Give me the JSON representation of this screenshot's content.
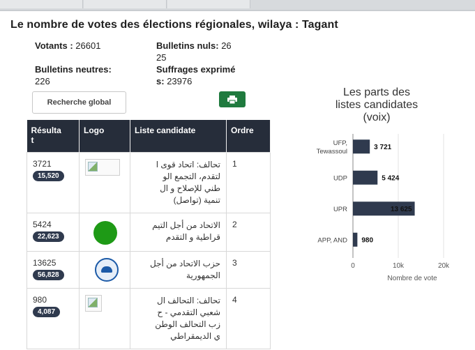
{
  "title": "Le nombre de votes des élections régionales, wilaya : Tagant",
  "stats": {
    "votants_label": "Votants :",
    "votants_value": "26601",
    "nuls_label": "Bulletins nuls:",
    "nuls_value_1": "26",
    "nuls_value_2": "25",
    "neutres_label": "Bulletins neutres:",
    "neutres_value": "226",
    "exprimes_label_1": "Suffrages exprimé",
    "exprimes_label_2": "s:",
    "exprimes_value": "23976"
  },
  "buttons": {
    "search_label": "Recherche global",
    "print_icon": "print-icon"
  },
  "table": {
    "headers": {
      "result_1": "Résulta",
      "result_2": "t",
      "logo": "Logo",
      "list": "Liste candidate",
      "order": "Ordre"
    },
    "rows": [
      {
        "votes": "3721",
        "badge": "15,520",
        "logo": "broken-image",
        "name_lines": [
          "تحالف: اتحاد قوى ا",
          "لتقدم، التجمع الو",
          "طني للإصلاح و ال",
          "تنمية (تواصل)"
        ],
        "order": "1"
      },
      {
        "votes": "5424",
        "badge": "22,623",
        "logo": "green-circle",
        "name_lines": [
          "الاتحاد من أجل التيم",
          "قراطية و التقدم"
        ],
        "order": "2"
      },
      {
        "votes": "13625",
        "badge": "56,828",
        "logo": "upr-emblem",
        "name_lines": [
          "حزب الاتحاد من أجل",
          "الجمهورية"
        ],
        "order": "3"
      },
      {
        "votes": "980",
        "badge": "4,087",
        "logo": "broken-image",
        "name_lines": [
          "تحالف: التحالف ال",
          "شعبي التقدمي - ح",
          "زب التحالف الوطن",
          "ي الديمقراطي"
        ],
        "order": "4"
      }
    ]
  },
  "chart_title_lines": [
    "Les parts des",
    "listes candidates",
    "(voix)"
  ],
  "chart_data": {
    "type": "bar",
    "orientation": "horizontal",
    "title": "Les parts des listes candidates (voix)",
    "categories": [
      "UFP, Tewassoul",
      "UDP",
      "UPR",
      "APP, AND"
    ],
    "category_lines": [
      [
        "UFP,",
        "Tewassoul"
      ],
      [
        "UDP"
      ],
      [
        "UPR"
      ],
      [
        "APP, AND"
      ]
    ],
    "values": [
      3721,
      5424,
      13625,
      980
    ],
    "value_labels": [
      "3 721",
      "5 424",
      "13 625",
      "980"
    ],
    "xlabel": "Nombre de vote",
    "xlim": [
      0,
      20000
    ],
    "ticks": [
      0,
      10000,
      20000
    ],
    "tick_labels": [
      "0",
      "10k",
      "20k"
    ],
    "bar_color": "#2f3a4e",
    "grid": true
  }
}
